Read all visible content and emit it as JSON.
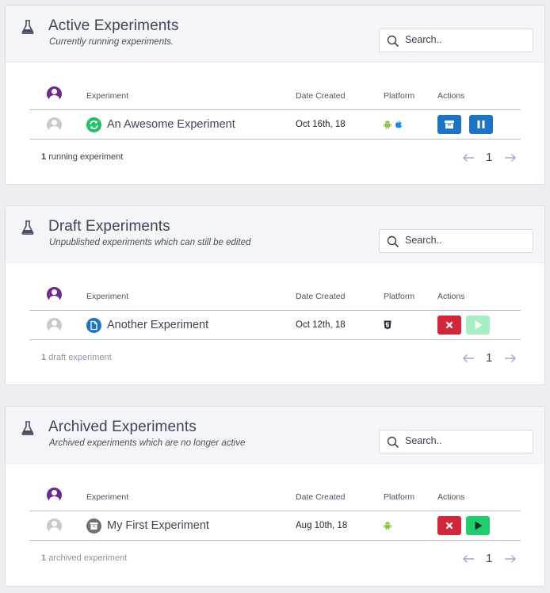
{
  "columns": {
    "experiment": "Experiment",
    "date_created": "Date Created",
    "platform": "Platform",
    "actions": "Actions"
  },
  "search_placeholder": "Search..",
  "colors": {
    "page_bg": "#edeef2",
    "header_bg": "#f4f5f9",
    "purple_avatar": "#6c2b8a",
    "blue_button": "#1b75c4",
    "red_button": "#d2273b",
    "green_button": "#1fcf6b",
    "android_green": "#8bc34a",
    "pager_arrow": "#b79bd1"
  },
  "panels": [
    {
      "title": "Active Experiments",
      "subtitle": "Currently running experiments.",
      "row": {
        "name": "An Awesome Experiment",
        "status_icon": "refresh-icon",
        "date": "Oct 16th, 18",
        "platforms": [
          "android-icon",
          "apple-icon"
        ],
        "actions": [
          "archive-icon",
          "pause-icon"
        ]
      },
      "footer": {
        "count": "1",
        "label": "running experiment"
      },
      "page": "1"
    },
    {
      "title": "Draft Experiments",
      "subtitle": "Unpublished experiments which can still be edited",
      "row": {
        "name": "Another Experiment",
        "status_icon": "document-icon",
        "date": "Oct 12th, 18",
        "platforms": [
          "html5-icon"
        ],
        "actions": [
          "delete-icon",
          "play-icon"
        ]
      },
      "footer": {
        "count": "1",
        "label": "draft experiment"
      },
      "page": "1"
    },
    {
      "title": "Archived Experiments",
      "subtitle": "Archived experiments which are no longer active",
      "row": {
        "name": "My First Experiment",
        "status_icon": "archive-box-icon",
        "date": "Aug 10th, 18",
        "platforms": [
          "android-icon"
        ],
        "actions": [
          "delete-icon",
          "play-icon"
        ]
      },
      "footer": {
        "count": "1",
        "label": "archived experiment"
      },
      "page": "1"
    }
  ]
}
